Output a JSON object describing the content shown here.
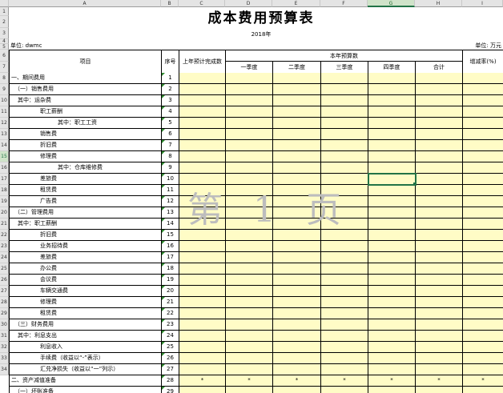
{
  "columns": [
    "A",
    "B",
    "C",
    "D",
    "E",
    "F",
    "G",
    "H",
    "I"
  ],
  "selected_column": "G",
  "row_numbers": [
    "1",
    "2",
    "3",
    "4",
    "5",
    "6",
    "7",
    "8",
    "9",
    "10",
    "11",
    "12",
    "13",
    "14",
    "15",
    "16",
    "17",
    "18",
    "19",
    "20",
    "21",
    "22",
    "23",
    "24",
    "25",
    "26",
    "27",
    "28",
    "29",
    "30",
    "31",
    "32",
    "33",
    "34"
  ],
  "selected_row": "15",
  "title": "成本费用预算表",
  "year": "2018年",
  "unit_left": "单位: dwmc",
  "unit_right": "单位: 万元",
  "headers": {
    "item": "项目",
    "seq": "序号",
    "last_year": "上年预计完成数",
    "budget_group": "本年预算数",
    "q1": "一季度",
    "q2": "二季度",
    "q3": "三季度",
    "q4": "四季度",
    "total": "合计",
    "growth": "增减率(%)"
  },
  "rows": [
    {
      "label": "一、期间费用",
      "seq": "1"
    },
    {
      "label": "（一）销售费用",
      "seq": "2"
    },
    {
      "label": "其中：运杂费",
      "seq": "3"
    },
    {
      "label": "职工薪酬",
      "seq": "4"
    },
    {
      "label": "其中：职工工资",
      "seq": "5"
    },
    {
      "label": "销售费",
      "seq": "6"
    },
    {
      "label": "折旧费",
      "seq": "7"
    },
    {
      "label": "修理费",
      "seq": "8"
    },
    {
      "label": "其中：仓库维修费",
      "seq": "9"
    },
    {
      "label": "差旅费",
      "seq": "10"
    },
    {
      "label": "租赁费",
      "seq": "11"
    },
    {
      "label": "广告费",
      "seq": "12"
    },
    {
      "label": "（二）管理费用",
      "seq": "13"
    },
    {
      "label": "其中：职工薪酬",
      "seq": "14"
    },
    {
      "label": "折旧费",
      "seq": "15"
    },
    {
      "label": "业务招待费",
      "seq": "16"
    },
    {
      "label": "差旅费",
      "seq": "17"
    },
    {
      "label": "办公费",
      "seq": "18"
    },
    {
      "label": "会议费",
      "seq": "19"
    },
    {
      "label": "车辆交通费",
      "seq": "20"
    },
    {
      "label": "修理费",
      "seq": "21"
    },
    {
      "label": "租赁费",
      "seq": "22"
    },
    {
      "label": "（三）财务费用",
      "seq": "23"
    },
    {
      "label": "其中：利息支出",
      "seq": "24"
    },
    {
      "label": "利息收入",
      "seq": "25"
    },
    {
      "label": "手续费（收益以“-”表示）",
      "seq": "26"
    },
    {
      "label": "汇兑净损失（收益以“一”列示）",
      "seq": "27"
    },
    {
      "label": "二、资产减值准备",
      "seq": "28",
      "placeholder": "*"
    },
    {
      "label": "（一）坏账准备",
      "seq": "29"
    }
  ],
  "watermark": "第 1 页",
  "colors": {
    "data_fill": "#fffcc6",
    "select": "#217346",
    "watermark": "#bdbdbd"
  }
}
